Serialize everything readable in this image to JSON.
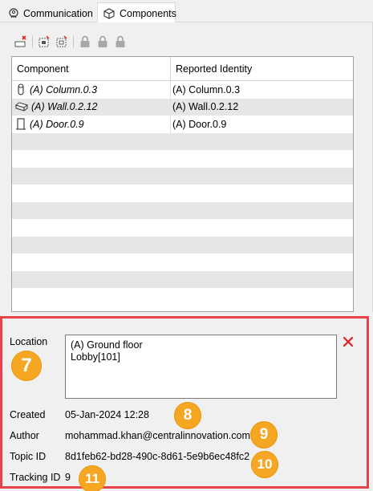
{
  "tabs": [
    {
      "label": "Communication",
      "icon": "communication-icon",
      "active": false
    },
    {
      "label": "Components",
      "icon": "components-cube-icon",
      "active": true
    }
  ],
  "toolbar": {
    "icons": [
      "remove-component-icon",
      "select-component-icon",
      "isolate-component-icon",
      "lock-icon",
      "lock-icon",
      "lock-icon"
    ]
  },
  "grid": {
    "columns": [
      "Component",
      "Reported Identity"
    ],
    "rows": [
      {
        "icon": "column-icon",
        "component": "(A) Column.0.3",
        "identity": "(A) Column.0.3"
      },
      {
        "icon": "wall-icon",
        "component": "(A) Wall.0.2.12",
        "identity": "(A) Wall.0.2.12"
      },
      {
        "icon": "door-icon",
        "component": "(A) Door.0.9",
        "identity": "(A) Door.0.9"
      }
    ]
  },
  "details": {
    "location_label": "Location",
    "location_lines": [
      "(A) Ground floor",
      "Lobby[101]"
    ],
    "created_label": "Created",
    "created_value": "05-Jan-2024 12:28",
    "author_label": "Author",
    "author_value": "mohammad.khan@centralinnovation.com",
    "topic_label": "Topic ID",
    "topic_value": "8d1feb62-bd28-490c-8d61-5e9b6ec48fc2",
    "tracking_label": "Tracking ID",
    "tracking_value": "9"
  },
  "badges": [
    "7",
    "8",
    "9",
    "10",
    "11"
  ],
  "colors": {
    "highlight_border": "#e8434b",
    "badge": "#f5a623",
    "close": "#e02020"
  }
}
